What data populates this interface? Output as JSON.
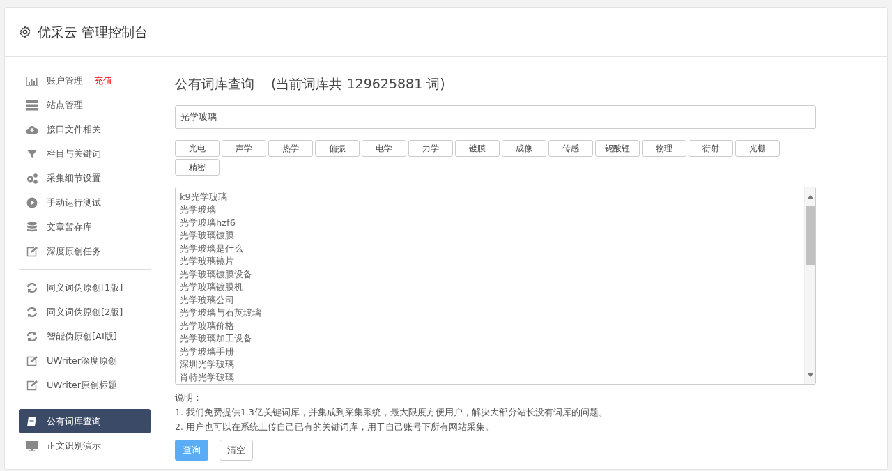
{
  "header": {
    "title": "优采云 管理控制台"
  },
  "sidebar": {
    "groups": [
      {
        "items": [
          {
            "label": "账户管理",
            "badge": "充值",
            "kind": "chart",
            "selected": false
          },
          {
            "label": "站点管理",
            "kind": "server",
            "selected": false
          },
          {
            "label": "接口文件相关",
            "kind": "cloud",
            "selected": false
          },
          {
            "label": "栏目与关键词",
            "kind": "filter",
            "selected": false
          },
          {
            "label": "采集细节设置",
            "kind": "gears",
            "selected": false
          },
          {
            "label": "手动运行测试",
            "kind": "play",
            "selected": false
          },
          {
            "label": "文章暂存库",
            "kind": "database",
            "selected": false
          },
          {
            "label": "深度原创任务",
            "kind": "edit",
            "selected": false
          }
        ]
      },
      {
        "items": [
          {
            "label": "同义词伪原创[1版]",
            "kind": "refresh",
            "selected": false
          },
          {
            "label": "同义词伪原创[2版]",
            "kind": "refresh",
            "selected": false
          },
          {
            "label": "智能伪原创[AI版]",
            "kind": "refresh",
            "selected": false
          },
          {
            "label": "UWriter深度原创",
            "kind": "edit",
            "selected": false
          },
          {
            "label": "UWriter原创标题",
            "kind": "edit",
            "selected": false
          }
        ]
      },
      {
        "items": [
          {
            "label": "公有词库查询",
            "kind": "book",
            "selected": true
          },
          {
            "label": "正文识别演示",
            "kind": "monitor",
            "selected": false
          }
        ]
      }
    ]
  },
  "main": {
    "title": "公有词库查询",
    "subtitle": "(当前词库共 129625881 词)",
    "search": {
      "value": "光学玻璃"
    },
    "tags": [
      "光电",
      "声学",
      "热学",
      "偏振",
      "电学",
      "力学",
      "镀膜",
      "成像",
      "传感",
      "铌酸锂",
      "物理",
      "衍射",
      "光栅",
      "精密"
    ],
    "results": [
      "k9光学玻璃",
      "光学玻璃",
      "光学玻璃hzf6",
      "光学玻璃镀膜",
      "光学玻璃是什么",
      "光学玻璃镜片",
      "光学玻璃镀膜设备",
      "光学玻璃镀膜机",
      "光学玻璃公司",
      "光学玻璃与石英玻璃",
      "光学玻璃价格",
      "光学玻璃加工设备",
      "光学玻璃手册",
      "深圳光学玻璃",
      "肖特光学玻璃"
    ],
    "notes": {
      "heading": "说明：",
      "lines": [
        "1. 我们免费提供1.3亿关键词库，并集成到采集系统，最大限度方便用户，解决大部分站长没有词库的问题。",
        "2. 用户也可以在系统上传自己已有的关键词库，用于自己账号下所有网站采集。"
      ]
    },
    "buttons": [
      {
        "label": "查询",
        "kind": "primary"
      },
      {
        "label": "清空",
        "kind": "default"
      }
    ]
  }
}
